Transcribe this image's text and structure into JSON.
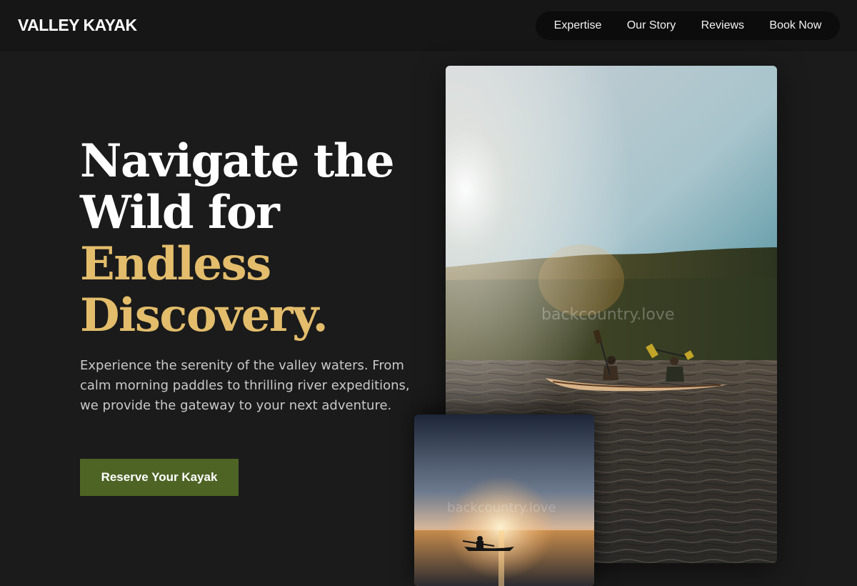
{
  "brand": {
    "name": "VALLEY KAYAK"
  },
  "nav": {
    "items": [
      {
        "label": "Expertise"
      },
      {
        "label": "Our Story"
      },
      {
        "label": "Reviews"
      },
      {
        "label": "Book Now"
      }
    ]
  },
  "hero": {
    "headline_line1": "Navigate the",
    "headline_line2": "Wild for",
    "headline_accent1": "Endless",
    "headline_accent2": "Discovery.",
    "description": "Experience the serenity of the valley waters. From calm morning paddles to thrilling river expeditions, we provide the gateway to your next adventure.",
    "cta_label": "Reserve Your Kayak"
  },
  "images": {
    "main_watermark": "backcountry.love",
    "small_watermark": "backcountry.love"
  },
  "colors": {
    "background": "#1b1b1b",
    "accent_gold": "#e3bd6c",
    "cta_green": "#4e6424"
  }
}
